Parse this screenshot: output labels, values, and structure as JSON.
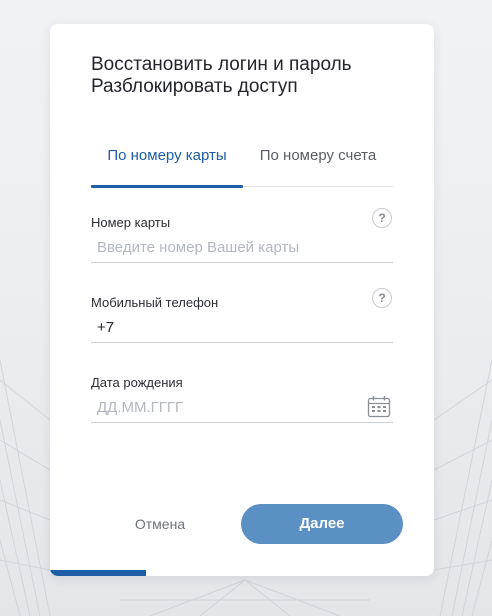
{
  "header": {
    "title_line1": "Восстановить логин и пароль",
    "title_line2": "Разблокировать доступ"
  },
  "tabs": [
    {
      "label": "По номеру карты",
      "active": true
    },
    {
      "label": "По номеру счета",
      "active": false
    }
  ],
  "fields": {
    "card_number": {
      "label": "Номер карты",
      "value": "",
      "placeholder": "Введите номер Вашей карты",
      "help_icon": "question-icon"
    },
    "phone": {
      "label": "Мобильный телефон",
      "value": "+7",
      "placeholder": "",
      "help_icon": "question-icon"
    },
    "birth_date": {
      "label": "Дата рождения",
      "value": "",
      "placeholder": "ДД.ММ.ГГГГ",
      "trailing_icon": "calendar-icon"
    }
  },
  "buttons": {
    "cancel_label": "Отмена",
    "next_label": "Далее"
  },
  "progress": {
    "fraction": 0.25
  },
  "colors": {
    "accent": "#1f5da6",
    "primary_button": "#5b90c5",
    "text": "#23252b",
    "muted": "#6f737b",
    "placeholder": "#b3b7bf"
  }
}
